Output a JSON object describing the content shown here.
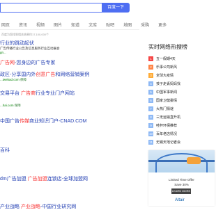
{
  "search": {
    "button": "百度一下"
  },
  "tabs": [
    "网页",
    "资讯",
    "视频",
    "图片",
    "知道",
    "文库",
    "贴吧",
    "地图",
    "采购",
    "更多"
  ],
  "stats": "百度为您找到相关结果约17,100,000个",
  "results": [
    {
      "title_pre": "",
      "title_hl": "",
      "title_post": "行业的跳动起伏",
      "desc": "广告传播行业公告及信息服务行业互动展会",
      "url": "gn...",
      "badge": ""
    },
    {
      "title_pre": "",
      "title_hl": "广告网",
      "title_post": "-您身边的广告专家",
      "desc": "",
      "url": "",
      "badge": ""
    },
    {
      "title_pre": "政区-分享国内外",
      "title_hl": "创意广告",
      "title_post": "和网络营销案例",
      "desc": "",
      "url": "...iwebad.com",
      "badge": "保障"
    },
    {
      "title_pre": "交易平台 ",
      "title_hl": "广告商",
      "title_post": "行业专业门户网站",
      "desc": "",
      "url": "...hai.com",
      "badge": "保障"
    },
    {
      "title_pre": "中国广告",
      "title_hl": "传媒",
      "title_post": "商业知识门户-CNAD.COM",
      "desc": "",
      "url": "",
      "badge": ""
    },
    {
      "title_pre": "",
      "title_hl": "",
      "title_post": "百科",
      "desc": "",
      "url": "",
      "badge": ""
    },
    {
      "title_pre": "dm广告加盟",
      "title_hl": " 广告加盟",
      "title_post": "连锁店-全球加盟网",
      "desc": "",
      "url": "",
      "badge": ""
    },
    {
      "title_pre": "产业战略",
      "title_hl": " 产业战略",
      "title_post": "-中国行业研究网",
      "desc": "",
      "url": "",
      "badge": ""
    }
  ],
  "hot": {
    "title": "实时网络热搜榜",
    "items": [
      "五一假期4天",
      "乐事公司新风",
      "全球大疫情",
      "孩子走丢妈妈找",
      "中国军事新闻",
      "国家卫健委情",
      "大热门猜谜",
      "三无运输直升机",
      "哇杯环保推荐",
      "百年老店情况",
      "无锡天地记者会"
    ]
  },
  "ad": {
    "line1": "Limited Time Offer",
    "line2": "Save 30%",
    "cta": "LEARN MORE",
    "brand": "Altair"
  }
}
